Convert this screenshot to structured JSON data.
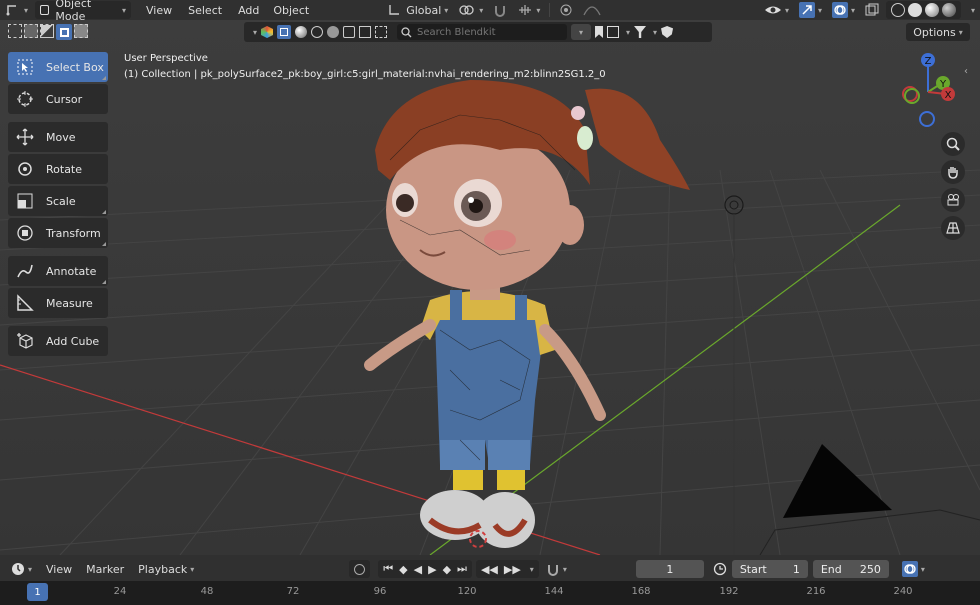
{
  "topbar": {
    "mode": "Object Mode",
    "menus": [
      "View",
      "Select",
      "Add",
      "Object"
    ],
    "orientation": "Global"
  },
  "viewport": {
    "search_placeholder": "Search Blendkit",
    "options": "Options",
    "perspective": "User Perspective",
    "collection": "(1) Collection | pk_polySurface2_pk:boy_girl:c5:girl_material:nvhai_rendering_m2:blinn2SG1.2_0"
  },
  "tools": [
    {
      "label": "Select Box",
      "icon": "select-box-icon",
      "active": true
    },
    {
      "label": "Cursor",
      "icon": "cursor-icon"
    },
    {
      "label": "Move",
      "icon": "move-icon"
    },
    {
      "label": "Rotate",
      "icon": "rotate-icon"
    },
    {
      "label": "Scale",
      "icon": "scale-icon"
    },
    {
      "label": "Transform",
      "icon": "transform-icon"
    },
    {
      "label": "Annotate",
      "icon": "annotate-icon"
    },
    {
      "label": "Measure",
      "icon": "measure-icon"
    },
    {
      "label": "Add Cube",
      "icon": "add-cube-icon"
    }
  ],
  "gizmo": {
    "z": "Z",
    "y": "Y",
    "x": "X"
  },
  "timeline": {
    "menus": [
      "View",
      "Marker",
      "Playback"
    ],
    "current_frame": "1",
    "start_label": "Start",
    "start": "1",
    "end_label": "End",
    "end": "250",
    "ruler_current": "1",
    "ticks": [
      "24",
      "48",
      "72",
      "96",
      "120",
      "144",
      "168",
      "192",
      "216",
      "240"
    ]
  },
  "colors": {
    "accent": "#4772b3",
    "x_axis": "#c23a3a",
    "y_axis": "#6aa82c",
    "z_axis": "#3d6fd6"
  }
}
